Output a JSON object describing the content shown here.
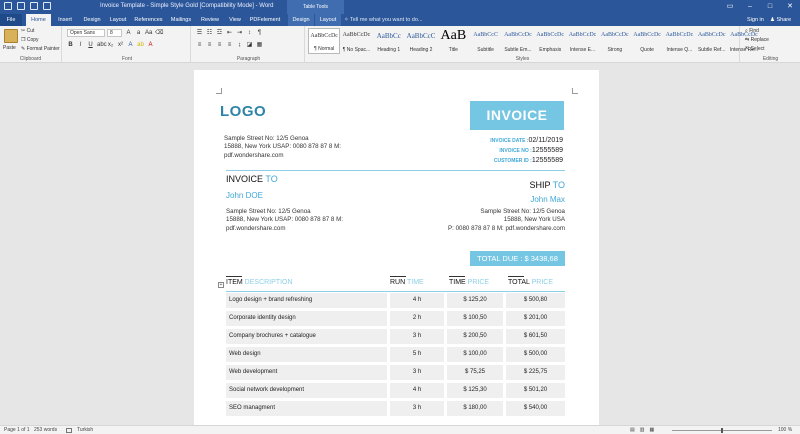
{
  "titlebar": {
    "title": "Invoice Template - Simple Style Gold [Compatibility Mode] - Word",
    "context_tab": "Table Tools"
  },
  "tabs": [
    "File",
    "Home",
    "Insert",
    "Design",
    "Layout",
    "References",
    "Mailings",
    "Review",
    "View",
    "PDFelement",
    "Design",
    "Layout"
  ],
  "tell_me": "Tell me what you want to do...",
  "signin": "Sign in",
  "share": "Share",
  "ribbon": {
    "clipboard": {
      "paste": "Paste",
      "cut": "Cut",
      "copy": "Copy",
      "format_painter": "Format Painter",
      "label": "Clipboard"
    },
    "font": {
      "name": "Open Sans",
      "size": "8",
      "label": "Font"
    },
    "paragraph": {
      "label": "Paragraph"
    },
    "styles": {
      "label": "Styles",
      "items": [
        {
          "preview": "AaBbCcDc",
          "name": "¶ Normal"
        },
        {
          "preview": "AaBbCcDc",
          "name": "¶ No Spac..."
        },
        {
          "preview": "AaBbCc",
          "name": "Heading 1"
        },
        {
          "preview": "AaBbCcC",
          "name": "Heading 2"
        },
        {
          "preview": "AaB",
          "name": "Title"
        },
        {
          "preview": "AaBbCcC",
          "name": "Subtitle"
        },
        {
          "preview": "AaBbCcDc",
          "name": "Subtle Em..."
        },
        {
          "preview": "AaBbCcDc",
          "name": "Emphasis"
        },
        {
          "preview": "AaBbCcDc",
          "name": "Intense E..."
        },
        {
          "preview": "AaBbCcDc",
          "name": "Strong"
        },
        {
          "preview": "AaBbCcDc",
          "name": "Quote"
        },
        {
          "preview": "AaBbCcDc",
          "name": "Intense Q..."
        },
        {
          "preview": "AaBbCcDc",
          "name": "Subtle Ref..."
        },
        {
          "preview": "AaBbCcDc",
          "name": "Intense Re..."
        }
      ]
    },
    "editing": {
      "find": "Find",
      "replace": "Replace",
      "select": "Select",
      "label": "Editing"
    }
  },
  "doc": {
    "logo": "LOGO",
    "invoice_title": "INVOICE",
    "sender_address": [
      "Sample Street No: 12/5 Genoa",
      "15888, New York USAP: 0080 878 87 8 M:",
      "pdf.wondershare.com"
    ],
    "meta": [
      {
        "label": "INVOICE DATE :",
        "value": "02/11/2019"
      },
      {
        "label": "INVOICE NO :",
        "value": "12555589"
      },
      {
        "label": "CUSTOMER ID :",
        "value": "12555589"
      }
    ],
    "invoice_to": {
      "a": "INVOICE ",
      "b": "TO",
      "name": "John DOE",
      "address": [
        "Sample Street No: 12/5 Genoa",
        "15888, New York USAP: 0080 878 87 8 M:",
        "pdf.wondershare.com"
      ]
    },
    "ship_to": {
      "a": "SHIP ",
      "b": "TO",
      "name": "John Max",
      "address": [
        "Sample Street No: 12/5 Genoa",
        "15888, New York USA",
        "P: 0080 878 87 8  M: pdf.wondershare.com"
      ]
    },
    "total_due": "TOTAL DUE : $ 3438,68",
    "columns": [
      {
        "a": "ITEM ",
        "b": "DESCRIPTION"
      },
      {
        "a": "RUN ",
        "b": "TIME"
      },
      {
        "a": "TIME ",
        "b": "PRICE"
      },
      {
        "a": "TOTAL ",
        "b": "PRICE"
      }
    ],
    "rows": [
      {
        "desc": "Logo design + brand refreshing",
        "time": "4 h",
        "price": "$ 125,20",
        "total": "$ 500,80"
      },
      {
        "desc": "Corporate identity design",
        "time": "2 h",
        "price": "$ 100,50",
        "total": "$ 201,00"
      },
      {
        "desc": "Company brochures + catalogue",
        "time": "3 h",
        "price": "$ 200,50",
        "total": "$ 601,50"
      },
      {
        "desc": "Web design",
        "time": "5 h",
        "price": "$ 100,00",
        "total": "$ 500,00"
      },
      {
        "desc": "Web development",
        "time": "3 h",
        "price": "$ 75,25",
        "total": "$ 225,75"
      },
      {
        "desc": "Social network development",
        "time": "4 h",
        "price": "$ 125,30",
        "total": "$ 501,20"
      },
      {
        "desc": "SEO managment",
        "time": "3 h",
        "price": "$ 180,00",
        "total": "$ 540,00"
      }
    ]
  },
  "status": {
    "page": "Page 1 of 1",
    "words": "253 words",
    "lang": "Turkish",
    "zoom": "100 %"
  },
  "colors": {
    "word_blue": "#2b579a",
    "accent": "#74c6e3",
    "accent_text": "#3fa8d6",
    "logo": "#2e84a8"
  }
}
